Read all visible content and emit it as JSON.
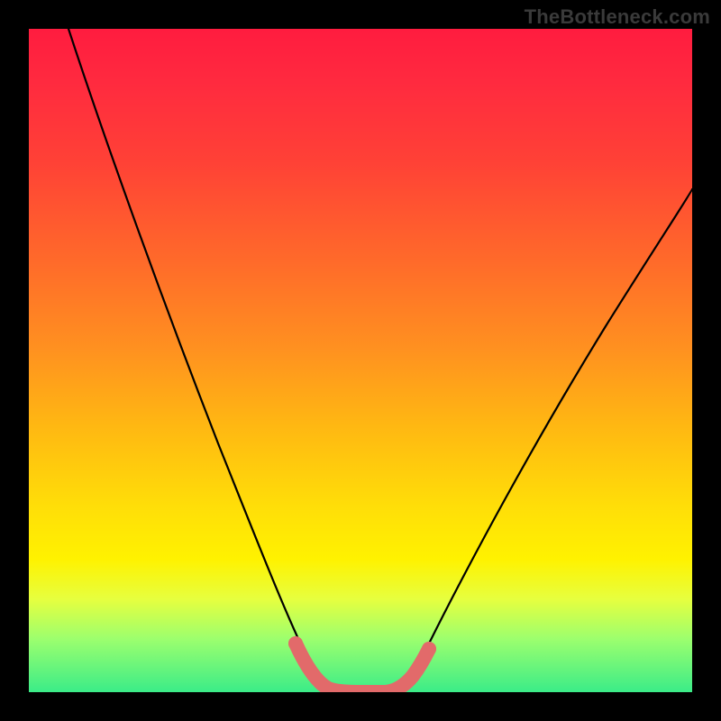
{
  "watermark": "TheBottleneck.com",
  "chart_data": {
    "type": "line",
    "title": "",
    "xlabel": "",
    "ylabel": "",
    "xlim": [
      0,
      100
    ],
    "ylim": [
      0,
      100
    ],
    "series": [
      {
        "name": "black-curve",
        "x": [
          6,
          10,
          15,
          20,
          25,
          30,
          34,
          38,
          40,
          42,
          44,
          47,
          50,
          53,
          56,
          60,
          66,
          72,
          80,
          90,
          100
        ],
        "y": [
          100,
          88,
          75,
          62,
          50,
          38,
          28,
          18,
          12,
          7,
          3,
          0,
          0,
          0,
          3,
          8,
          17,
          27,
          40,
          55,
          68
        ]
      },
      {
        "name": "pink-highlight",
        "x": [
          40,
          42,
          44,
          47,
          50,
          53,
          56,
          58
        ],
        "y": [
          8,
          4,
          1,
          0,
          0,
          0,
          2,
          5
        ]
      }
    ],
    "background_gradient": {
      "top": "#ff1c3f",
      "bottom": "#3bec88"
    }
  }
}
